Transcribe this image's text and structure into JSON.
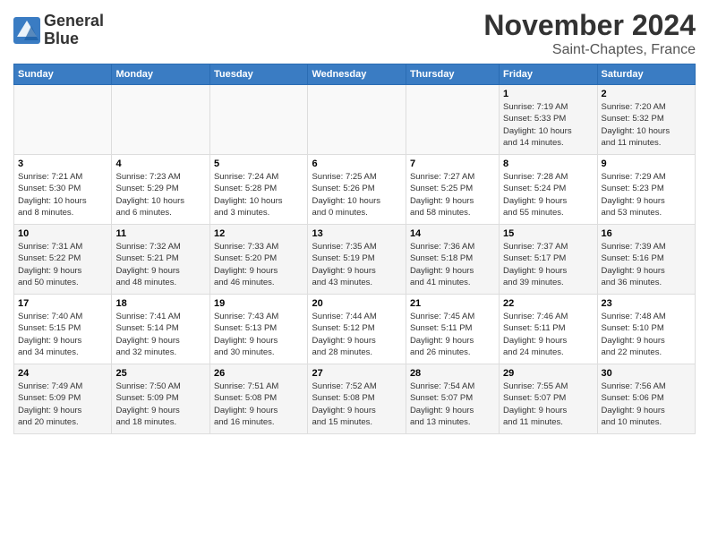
{
  "header": {
    "logo_line1": "General",
    "logo_line2": "Blue",
    "month": "November 2024",
    "location": "Saint-Chaptes, France"
  },
  "weekdays": [
    "Sunday",
    "Monday",
    "Tuesday",
    "Wednesday",
    "Thursday",
    "Friday",
    "Saturday"
  ],
  "weeks": [
    [
      {
        "day": "",
        "info": ""
      },
      {
        "day": "",
        "info": ""
      },
      {
        "day": "",
        "info": ""
      },
      {
        "day": "",
        "info": ""
      },
      {
        "day": "",
        "info": ""
      },
      {
        "day": "1",
        "info": "Sunrise: 7:19 AM\nSunset: 5:33 PM\nDaylight: 10 hours\nand 14 minutes."
      },
      {
        "day": "2",
        "info": "Sunrise: 7:20 AM\nSunset: 5:32 PM\nDaylight: 10 hours\nand 11 minutes."
      }
    ],
    [
      {
        "day": "3",
        "info": "Sunrise: 7:21 AM\nSunset: 5:30 PM\nDaylight: 10 hours\nand 8 minutes."
      },
      {
        "day": "4",
        "info": "Sunrise: 7:23 AM\nSunset: 5:29 PM\nDaylight: 10 hours\nand 6 minutes."
      },
      {
        "day": "5",
        "info": "Sunrise: 7:24 AM\nSunset: 5:28 PM\nDaylight: 10 hours\nand 3 minutes."
      },
      {
        "day": "6",
        "info": "Sunrise: 7:25 AM\nSunset: 5:26 PM\nDaylight: 10 hours\nand 0 minutes."
      },
      {
        "day": "7",
        "info": "Sunrise: 7:27 AM\nSunset: 5:25 PM\nDaylight: 9 hours\nand 58 minutes."
      },
      {
        "day": "8",
        "info": "Sunrise: 7:28 AM\nSunset: 5:24 PM\nDaylight: 9 hours\nand 55 minutes."
      },
      {
        "day": "9",
        "info": "Sunrise: 7:29 AM\nSunset: 5:23 PM\nDaylight: 9 hours\nand 53 minutes."
      }
    ],
    [
      {
        "day": "10",
        "info": "Sunrise: 7:31 AM\nSunset: 5:22 PM\nDaylight: 9 hours\nand 50 minutes."
      },
      {
        "day": "11",
        "info": "Sunrise: 7:32 AM\nSunset: 5:21 PM\nDaylight: 9 hours\nand 48 minutes."
      },
      {
        "day": "12",
        "info": "Sunrise: 7:33 AM\nSunset: 5:20 PM\nDaylight: 9 hours\nand 46 minutes."
      },
      {
        "day": "13",
        "info": "Sunrise: 7:35 AM\nSunset: 5:19 PM\nDaylight: 9 hours\nand 43 minutes."
      },
      {
        "day": "14",
        "info": "Sunrise: 7:36 AM\nSunset: 5:18 PM\nDaylight: 9 hours\nand 41 minutes."
      },
      {
        "day": "15",
        "info": "Sunrise: 7:37 AM\nSunset: 5:17 PM\nDaylight: 9 hours\nand 39 minutes."
      },
      {
        "day": "16",
        "info": "Sunrise: 7:39 AM\nSunset: 5:16 PM\nDaylight: 9 hours\nand 36 minutes."
      }
    ],
    [
      {
        "day": "17",
        "info": "Sunrise: 7:40 AM\nSunset: 5:15 PM\nDaylight: 9 hours\nand 34 minutes."
      },
      {
        "day": "18",
        "info": "Sunrise: 7:41 AM\nSunset: 5:14 PM\nDaylight: 9 hours\nand 32 minutes."
      },
      {
        "day": "19",
        "info": "Sunrise: 7:43 AM\nSunset: 5:13 PM\nDaylight: 9 hours\nand 30 minutes."
      },
      {
        "day": "20",
        "info": "Sunrise: 7:44 AM\nSunset: 5:12 PM\nDaylight: 9 hours\nand 28 minutes."
      },
      {
        "day": "21",
        "info": "Sunrise: 7:45 AM\nSunset: 5:11 PM\nDaylight: 9 hours\nand 26 minutes."
      },
      {
        "day": "22",
        "info": "Sunrise: 7:46 AM\nSunset: 5:11 PM\nDaylight: 9 hours\nand 24 minutes."
      },
      {
        "day": "23",
        "info": "Sunrise: 7:48 AM\nSunset: 5:10 PM\nDaylight: 9 hours\nand 22 minutes."
      }
    ],
    [
      {
        "day": "24",
        "info": "Sunrise: 7:49 AM\nSunset: 5:09 PM\nDaylight: 9 hours\nand 20 minutes."
      },
      {
        "day": "25",
        "info": "Sunrise: 7:50 AM\nSunset: 5:09 PM\nDaylight: 9 hours\nand 18 minutes."
      },
      {
        "day": "26",
        "info": "Sunrise: 7:51 AM\nSunset: 5:08 PM\nDaylight: 9 hours\nand 16 minutes."
      },
      {
        "day": "27",
        "info": "Sunrise: 7:52 AM\nSunset: 5:08 PM\nDaylight: 9 hours\nand 15 minutes."
      },
      {
        "day": "28",
        "info": "Sunrise: 7:54 AM\nSunset: 5:07 PM\nDaylight: 9 hours\nand 13 minutes."
      },
      {
        "day": "29",
        "info": "Sunrise: 7:55 AM\nSunset: 5:07 PM\nDaylight: 9 hours\nand 11 minutes."
      },
      {
        "day": "30",
        "info": "Sunrise: 7:56 AM\nSunset: 5:06 PM\nDaylight: 9 hours\nand 10 minutes."
      }
    ]
  ]
}
